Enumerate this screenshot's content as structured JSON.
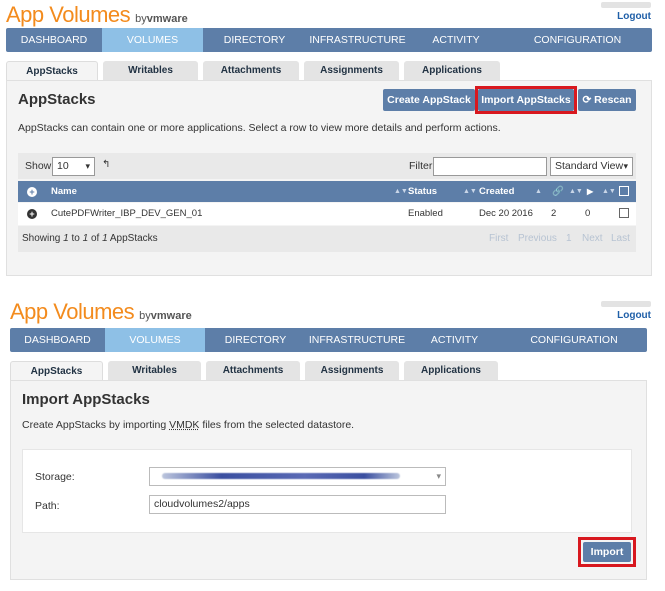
{
  "brand": {
    "name": "App Volumes",
    "by": "by",
    "vendor": "vmware"
  },
  "header": {
    "logout_label": "Logout"
  },
  "nav": [
    "DASHBOARD",
    "VOLUMES",
    "DIRECTORY",
    "INFRASTRUCTURE",
    "ACTIVITY",
    "CONFIGURATION"
  ],
  "nav_active": "VOLUMES",
  "tabs": [
    "AppStacks",
    "Writables",
    "Attachments",
    "Assignments",
    "Applications"
  ],
  "tab_active": "AppStacks",
  "colors": {
    "brand_orange": "#f38b1d",
    "nav_bg": "#5d7ea8",
    "nav_active": "#8ec0e6",
    "highlight_box": "#d8181f"
  },
  "screen1": {
    "title": "AppStacks",
    "description": "AppStacks can contain one or more applications. Select a row to view more details and perform actions.",
    "buttons": {
      "create": "Create AppStack",
      "import": "Import AppStacks",
      "rescan": "Rescan"
    },
    "rescan_icon": "refresh-icon",
    "show_label": "Show",
    "show_value": "10",
    "filter_label": "Filter",
    "filter_value": "",
    "view_select": "Standard View",
    "columns": {
      "name": "Name",
      "status": "Status",
      "created": "Created"
    },
    "rows": [
      {
        "name": "CutePDFWriter_IBP_DEV_GEN_01",
        "status": "Enabled",
        "created": "Dec 20 2016",
        "count_a": "2",
        "count_b": "0"
      }
    ],
    "footer": {
      "showing": "Showing",
      "from": "1",
      "to_word": "to",
      "to": "1",
      "of_word": "of",
      "total": "1",
      "suffix": "AppStacks"
    },
    "pager": {
      "first": "First",
      "previous": "Previous",
      "page": "1",
      "next": "Next",
      "last": "Last"
    }
  },
  "screen2": {
    "title": "Import AppStacks",
    "description_prefix": "Create AppStacks by importing",
    "description_link": "VMDK",
    "description_suffix": "files from the selected datastore.",
    "storage_label": "Storage:",
    "path_label": "Path:",
    "path_value": "cloudvolumes2/apps",
    "import_button": "Import"
  }
}
